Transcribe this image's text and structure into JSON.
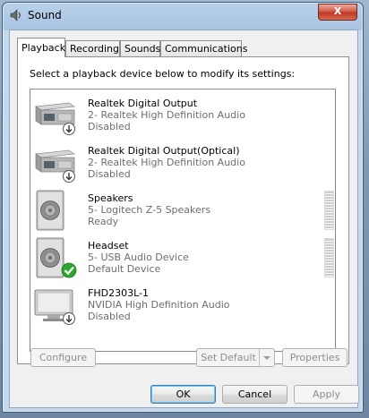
{
  "window": {
    "title": "Sound",
    "close_label": "X"
  },
  "tabs": [
    {
      "label": "Playback"
    },
    {
      "label": "Recording"
    },
    {
      "label": "Sounds"
    },
    {
      "label": "Communications"
    }
  ],
  "instruction": "Select a playback device below to modify its settings:",
  "devices": [
    {
      "name": "Realtek Digital Output",
      "description": "2- Realtek High Definition Audio",
      "status": "Disabled",
      "icon": "digital-output-icon",
      "badge": "disabled-arrow"
    },
    {
      "name": "Realtek Digital Output(Optical)",
      "description": "2- Realtek High Definition Audio",
      "status": "Disabled",
      "icon": "digital-output-icon",
      "badge": "disabled-arrow"
    },
    {
      "name": "Speakers",
      "description": "5- Logitech Z-5 Speakers",
      "status": "Ready",
      "icon": "speaker-icon",
      "badge": "none"
    },
    {
      "name": "Headset",
      "description": "5- USB Audio Device",
      "status": "Default Device",
      "icon": "speaker-icon",
      "badge": "default-check"
    },
    {
      "name": "FHD2303L-1",
      "description": "NVIDIA High Definition Audio",
      "status": "Disabled",
      "icon": "monitor-icon",
      "badge": "disabled-arrow"
    }
  ],
  "buttons": {
    "configure": "Configure",
    "set_default": "Set Default",
    "properties": "Properties",
    "ok": "OK",
    "cancel": "Cancel",
    "apply": "Apply"
  },
  "colors": {
    "check_green": "#2fa72f",
    "window_frame": "#b9d1ea"
  }
}
